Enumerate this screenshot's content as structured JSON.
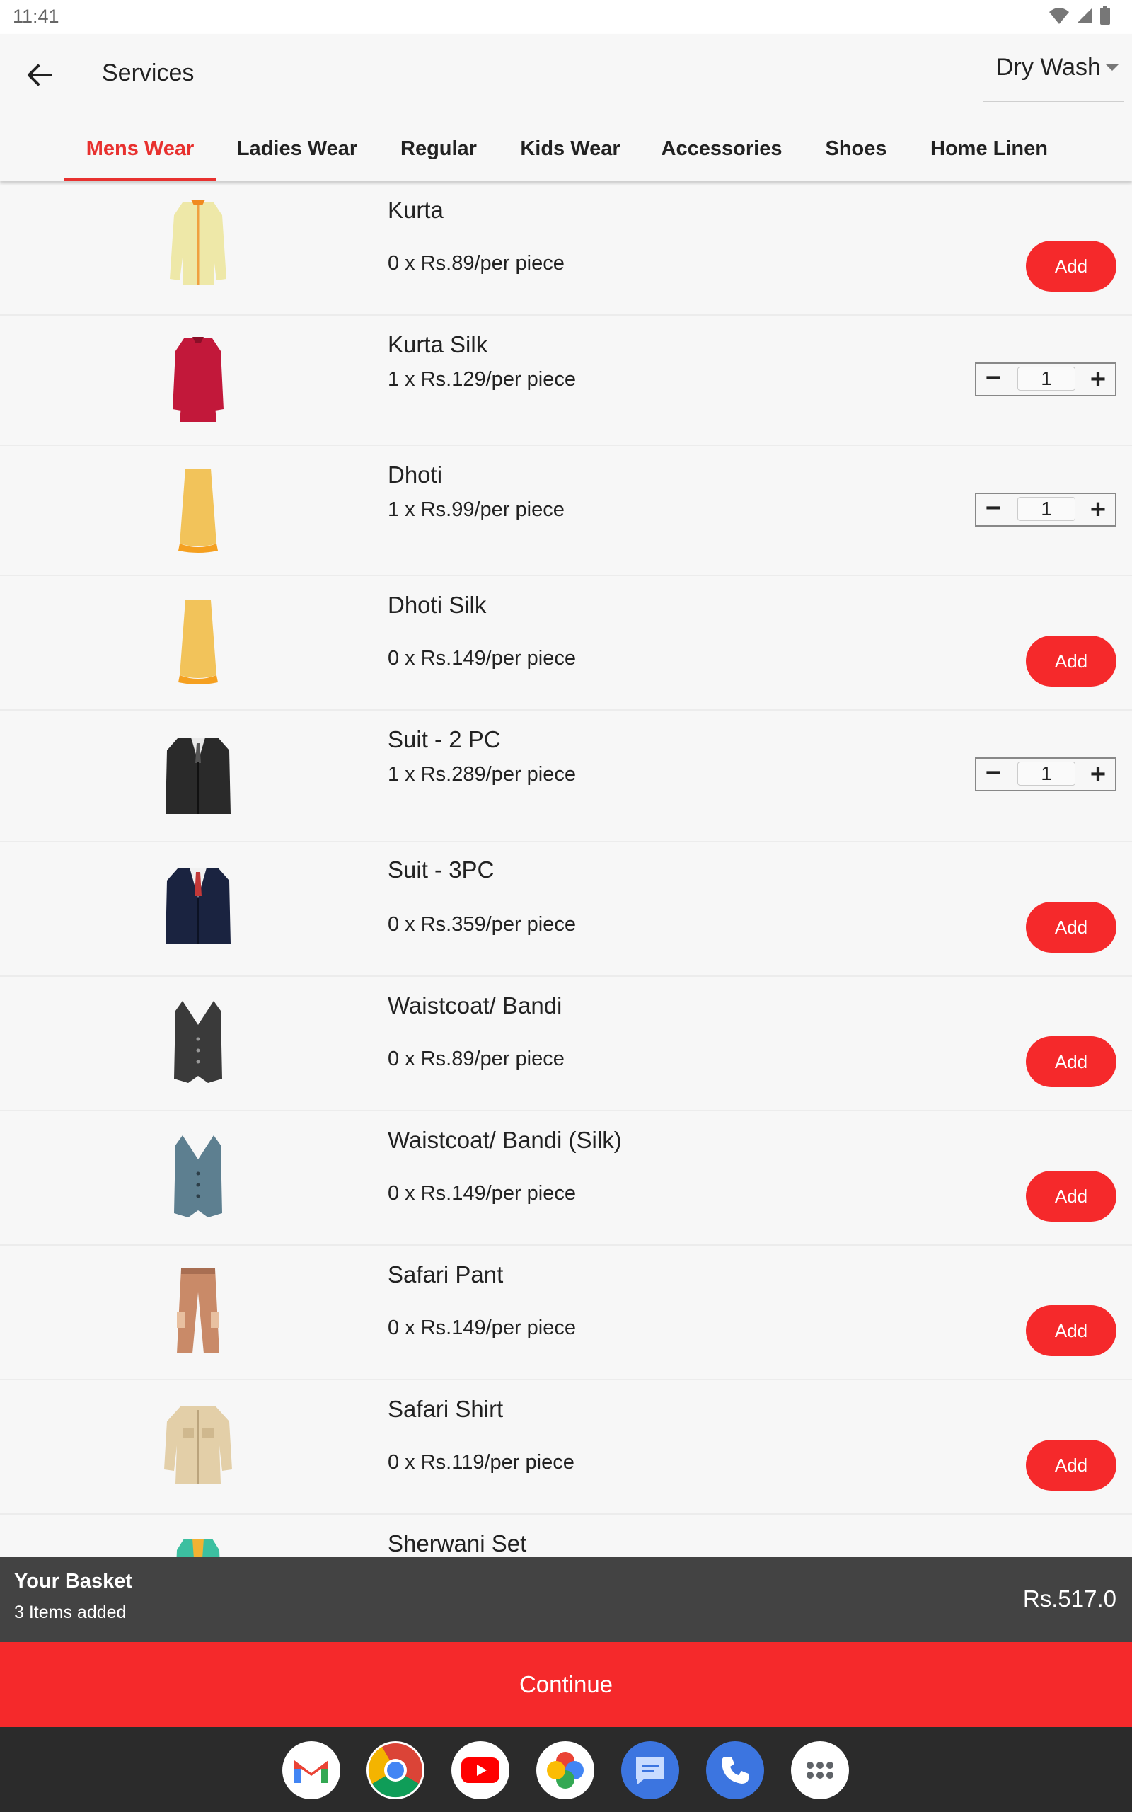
{
  "status_bar": {
    "time": "11:41"
  },
  "header": {
    "title": "Services",
    "service_type": "Dry Wash"
  },
  "tabs": [
    {
      "label": "Mens Wear",
      "active": true
    },
    {
      "label": "Ladies Wear",
      "active": false
    },
    {
      "label": "Regular",
      "active": false
    },
    {
      "label": "Kids Wear",
      "active": false
    },
    {
      "label": "Accessories",
      "active": false
    },
    {
      "label": "Shoes",
      "active": false
    },
    {
      "label": "Home Linen",
      "active": false
    }
  ],
  "items": [
    {
      "name": "Kurta",
      "price_text": "0 x Rs.89/per piece",
      "quantity": 0,
      "icon": "kurta-icon"
    },
    {
      "name": "Kurta Silk",
      "price_text": "1 x Rs.129/per piece",
      "quantity": 1,
      "icon": "kurta-silk-icon"
    },
    {
      "name": "Dhoti",
      "price_text": "1 x Rs.99/per piece",
      "quantity": 1,
      "icon": "dhoti-icon"
    },
    {
      "name": "Dhoti Silk",
      "price_text": "0 x Rs.149/per piece",
      "quantity": 0,
      "icon": "dhoti-silk-icon"
    },
    {
      "name": "Suit - 2 PC",
      "price_text": "1 x Rs.289/per piece",
      "quantity": 1,
      "icon": "suit-2pc-icon"
    },
    {
      "name": "Suit - 3PC",
      "price_text": "0 x Rs.359/per piece",
      "quantity": 0,
      "icon": "suit-3pc-icon"
    },
    {
      "name": "Waistcoat/ Bandi",
      "price_text": "0 x Rs.89/per piece",
      "quantity": 0,
      "icon": "waistcoat-icon"
    },
    {
      "name": "Waistcoat/ Bandi (Silk)",
      "price_text": "0 x Rs.149/per piece",
      "quantity": 0,
      "icon": "waistcoat-silk-icon"
    },
    {
      "name": "Safari Pant",
      "price_text": "0 x Rs.149/per piece",
      "quantity": 0,
      "icon": "safari-pant-icon"
    },
    {
      "name": "Safari Shirt",
      "price_text": "0 x Rs.119/per piece",
      "quantity": 0,
      "icon": "safari-shirt-icon"
    },
    {
      "name": "Sherwani Set",
      "price_text": "",
      "quantity": 0,
      "icon": "sherwani-icon"
    }
  ],
  "add_label": "Add",
  "stepper": {
    "minus": "−",
    "plus": "+"
  },
  "basket": {
    "title": "Your Basket",
    "count_text": "3 Items added",
    "total": "Rs.517.0"
  },
  "continue_label": "Continue",
  "dock": [
    "gmail-icon",
    "chrome-icon",
    "youtube-icon",
    "photos-icon",
    "messages-icon",
    "phone-icon",
    "app-drawer-icon"
  ],
  "colors": {
    "accent": "#f5292b",
    "tab_active": "#e8312f",
    "basket_bg": "#434343",
    "navbar_bg": "#2b2b2b"
  }
}
